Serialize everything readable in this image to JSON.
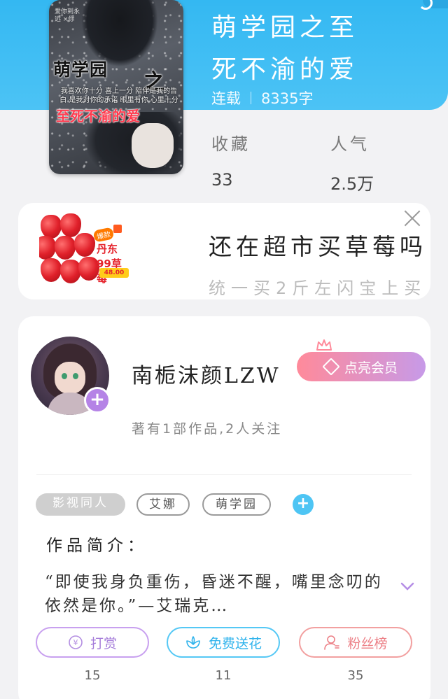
{
  "book": {
    "title_line1": "萌学园之至",
    "title_line2": "死不渝的爱",
    "status": "连载",
    "word_count": "8335字",
    "cover": {
      "title": "萌学园",
      "zhi": "之",
      "subtitle": "至死不渝的爱",
      "blurb": "我喜欢你十分 喜上一分 陪伴是我的告白 是我对你的承诺 眼里有你 心里十分",
      "handwriting": "爱你到永远 ×你"
    },
    "stats": {
      "favorites_label": "收藏",
      "favorites_value": "33",
      "popularity_label": "人气",
      "popularity_value": "2.5万"
    }
  },
  "ad": {
    "badge": "爆款",
    "brand": "丹东99草莓",
    "price": "48.00",
    "headline": "还在超市买草莓吗",
    "second_line": "统一买2斤左闪宝上买"
  },
  "author": {
    "name": "南栀沫颜LZW",
    "vip_label": "点亮会员",
    "stats": "著有1部作品,2人关注"
  },
  "tags": {
    "category": "影视同人",
    "items": [
      "艾娜",
      "萌学园"
    ]
  },
  "intro": {
    "label": "作品简介：",
    "text": "“即使我身负重伤，昏迷不醒，嘴里念叨的依然是你。”—艾瑞克…"
  },
  "actions": [
    {
      "label": "打赏",
      "count": "15",
      "icon": "yen-icon"
    },
    {
      "label": "免费送花",
      "count": "11",
      "icon": "flower-icon"
    },
    {
      "label": "粉丝榜",
      "count": "35",
      "icon": "user-icon"
    }
  ],
  "colors": {
    "header_blue": "#34b8f2",
    "vip_gradient_start": "#ff8a9a",
    "vip_gradient_end": "#c79ae8",
    "reward_purple": "#a57cda",
    "flower_blue": "#2fb3ec",
    "fans_pink": "#ec7f86",
    "tag_add_blue": "#4ec5f4"
  }
}
